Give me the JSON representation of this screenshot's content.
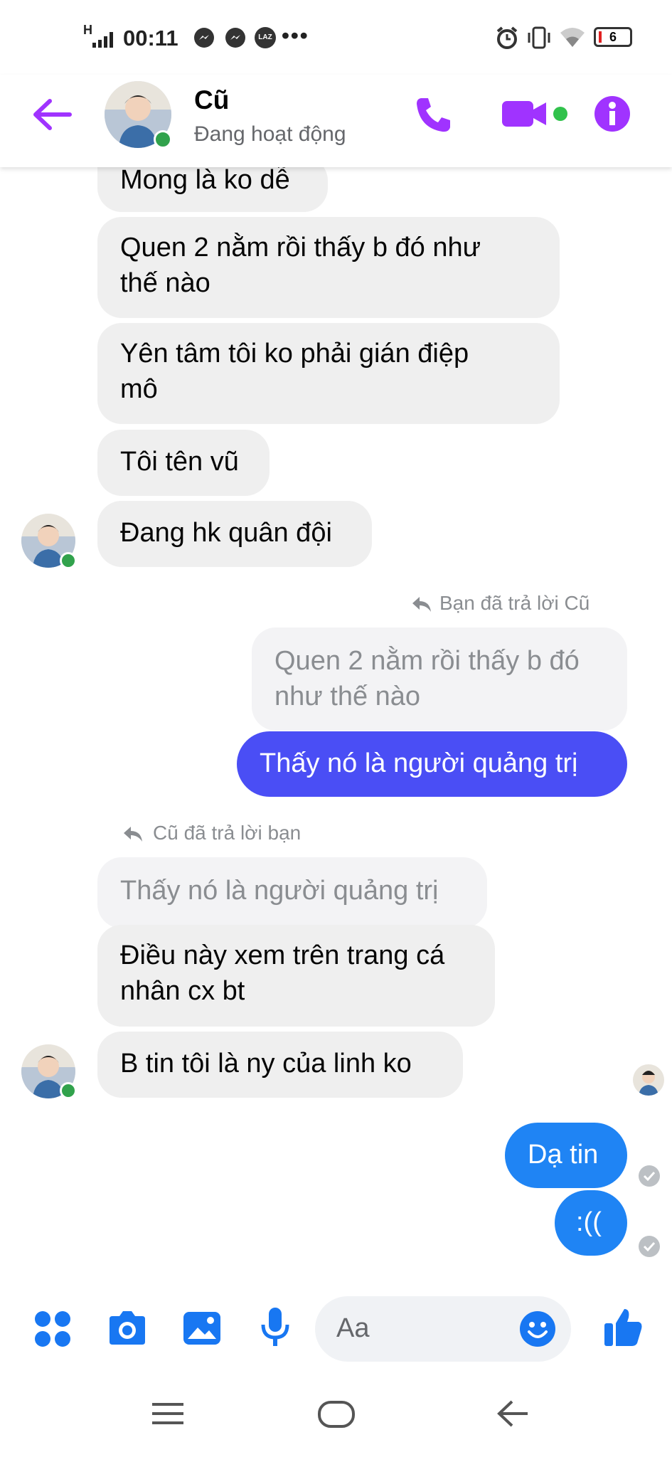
{
  "status_bar": {
    "signal": "H",
    "time": "00:11",
    "more": "•••",
    "app_badge": "LAZ",
    "battery": "6"
  },
  "header": {
    "name": "Cũ",
    "status": "Đang hoạt động",
    "colors": {
      "accent": "#a033ff",
      "online": "#31a24c"
    }
  },
  "messages": {
    "m1": "Mong là ko dễ",
    "m2": [
      "Quen 2 nằm rồi thấy b đó như",
      "thế nào"
    ],
    "m3": [
      "Yên tâm tôi ko phải gián điệp",
      "mô"
    ],
    "m4": "Tôi tên vũ",
    "m5": "Đang hk quân đội",
    "reply_note_1": "Bạn đã trả lời Cũ",
    "quote_1": [
      "Quen 2 nằm rồi thấy b đó",
      "như thế nào"
    ],
    "m6": "Thấy nó là người quảng trị",
    "reply_note_2": "Cũ đã trả lời bạn",
    "quote_2": "Thấy nó là người quảng trị",
    "m7": [
      "Điều này xem trên trang cá",
      "nhân cx bt"
    ],
    "m8": "B tin tôi là ny của linh ko",
    "m9": "Dạ tin",
    "m10": ":(("
  },
  "composer": {
    "placeholder": "Aa"
  },
  "icons": {
    "back": "back-arrow-icon",
    "call": "phone-icon",
    "video": "video-icon",
    "info": "info-icon",
    "apps": "apps-icon",
    "camera": "camera-icon",
    "gallery": "image-icon",
    "mic": "microphone-icon",
    "emoji": "emoji-icon",
    "like": "thumbs-up-icon"
  },
  "colors": {
    "bubble_in": "#efefef",
    "bubble_out": "#4a4ef5",
    "bubble_blue": "#1f84f4",
    "composer_icon": "#1877f2"
  }
}
